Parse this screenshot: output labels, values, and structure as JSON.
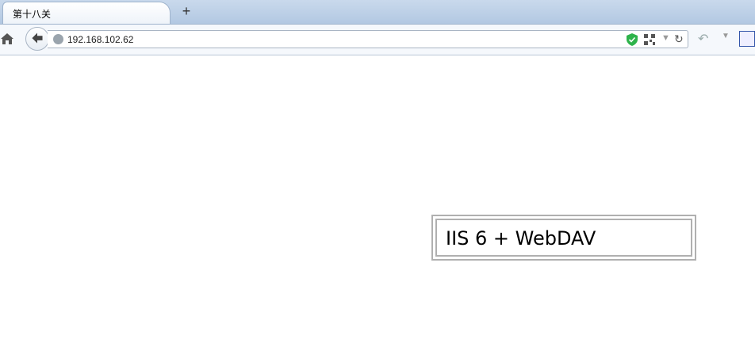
{
  "browser": {
    "tab_title": "第十八关",
    "new_tab_symbol": "+",
    "url": "192.168.102.62",
    "icons": [
      "home-icon",
      "back-arrow-icon",
      "globe-icon",
      "shield-icon",
      "qr-code-icon",
      "dropdown-arrow-icon",
      "reload-icon",
      "undo-icon",
      "paw-icon"
    ]
  },
  "page": {
    "box_text": "IIS 6 + WebDAV"
  }
}
